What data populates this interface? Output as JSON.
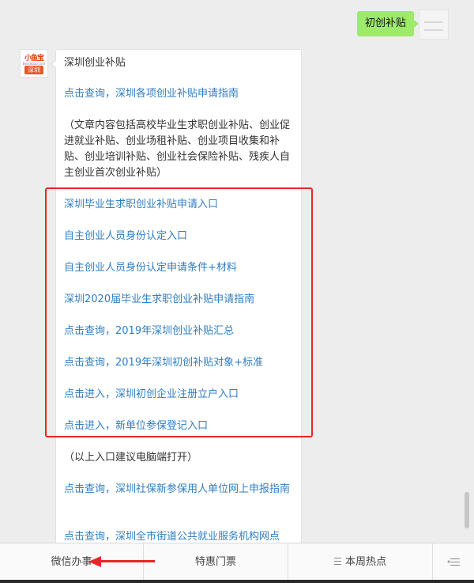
{
  "chat": {
    "outgoing": {
      "text": "初创补贴"
    },
    "incoming": {
      "avatar": {
        "logo_text": "小鱼宝",
        "site_text": "Bendibao.com",
        "city_text": "深圳"
      },
      "title": "深圳创业补贴",
      "intro_link": "点击查询，深圳各项创业补贴申请指南",
      "note": "（文章内容包括高校毕业生求职创业补贴、创业促进就业补贴、创业场租补贴、创业项目收集和补贴、创业培训补贴、创业社会保险补贴、残疾人自主创业首次创业补贴）",
      "highlighted_links": [
        "深圳毕业生求职创业补贴申请入口",
        "自主创业人员身份认定入口",
        "自主创业人员身份认定申请条件+材料",
        "深圳2020届毕业生求职创业补贴申请指南",
        "点击查询，2019年深圳创业补贴汇总",
        "点击查询，2019年深圳初创补贴对象+标准",
        "点击进入，深圳初创企业注册立户入口",
        "点击进入，新单位参保登记入口"
      ],
      "tip": "（以上入口建议电脑端打开）",
      "more_links": [
        "点击查询，深圳社保新参保用人单位网上申报指南",
        "点击查询，深圳全市街道公共就业服务机构网点"
      ]
    }
  },
  "menu": {
    "items": [
      {
        "label": "微信办事"
      },
      {
        "label": "特惠门票"
      },
      {
        "label": "本周热点"
      }
    ]
  },
  "colors": {
    "link": "#2f7ec2",
    "outgoing_bubble": "#9eea6a",
    "highlight": "#e8262a"
  }
}
